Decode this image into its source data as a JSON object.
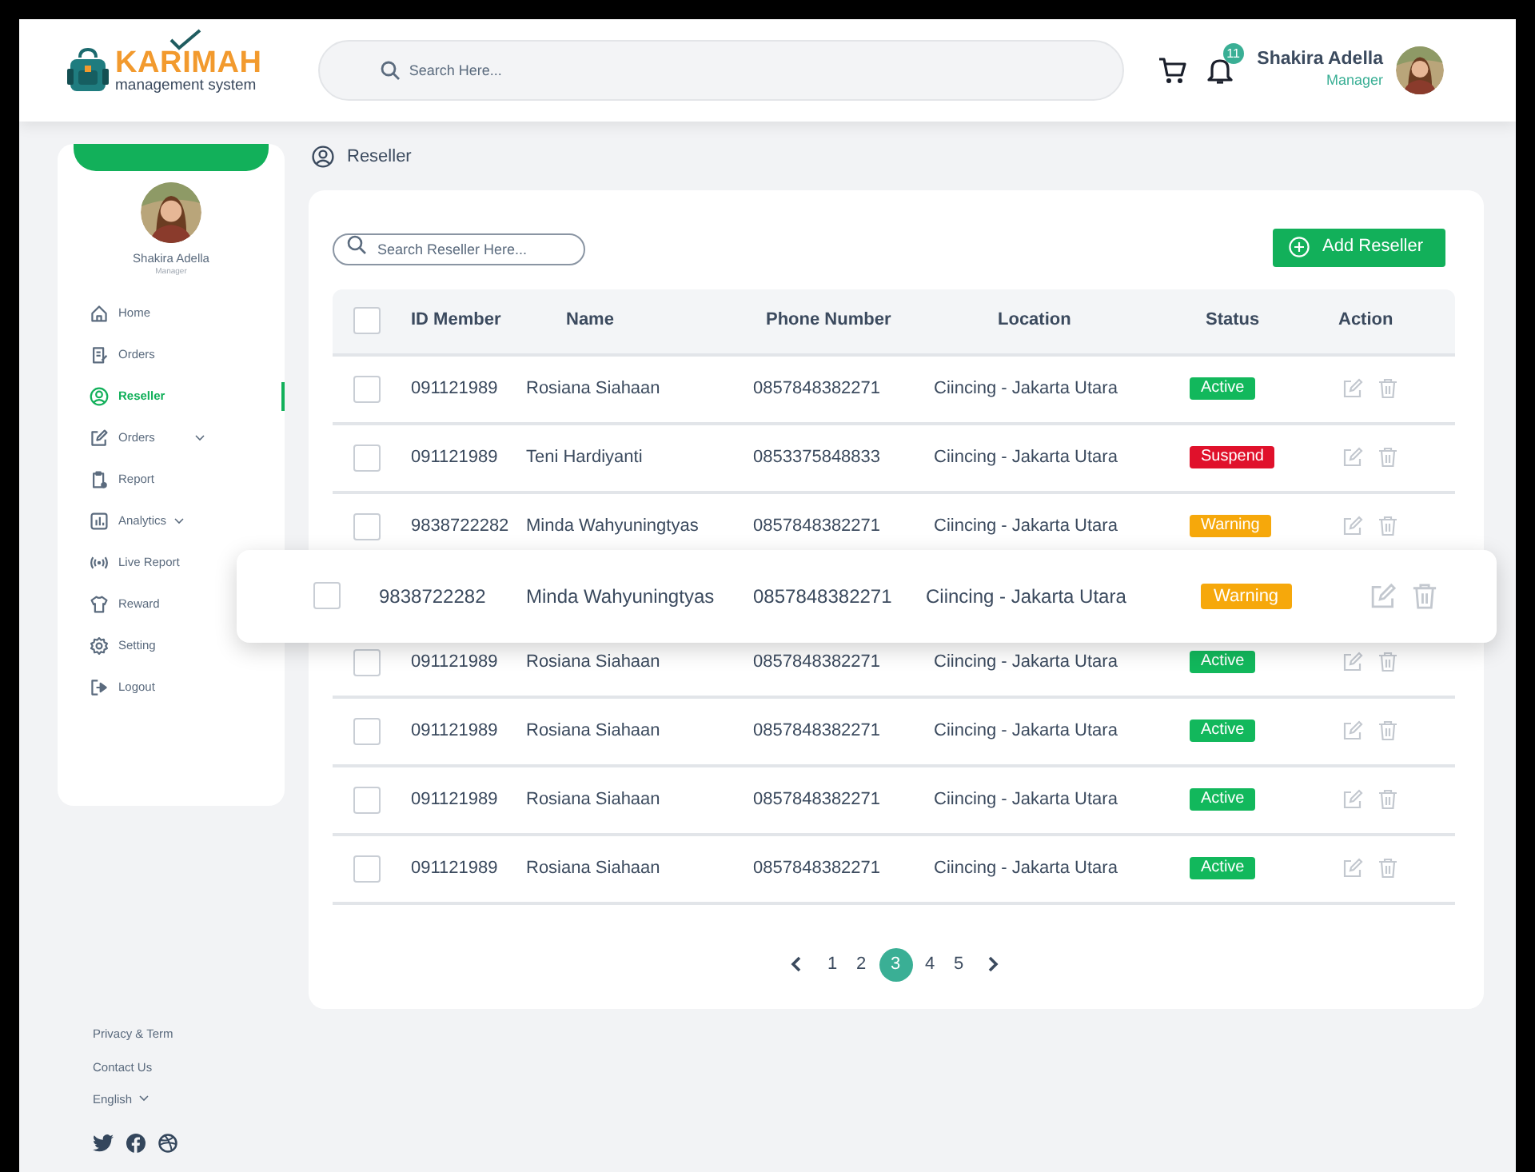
{
  "header": {
    "logo": {
      "title": "KARIMAH",
      "tagline": "management system"
    },
    "search": {
      "placeholder": "Search Here..."
    },
    "notifications": {
      "count": "11"
    },
    "user": {
      "name": "Shakira Adella",
      "role": "Manager"
    }
  },
  "sidebar": {
    "profile": {
      "name": "Shakira Adella",
      "role": "Manager"
    },
    "items": [
      {
        "label": "Home",
        "selected": false,
        "submenu": false
      },
      {
        "label": "Orders",
        "selected": false,
        "submenu": false
      },
      {
        "label": "Reseller",
        "selected": true,
        "submenu": false
      },
      {
        "label": "Orders",
        "selected": false,
        "submenu": true
      },
      {
        "label": "Report",
        "selected": false,
        "submenu": false
      },
      {
        "label": "Analytics",
        "selected": false,
        "submenu": true
      },
      {
        "label": "Live Report",
        "selected": false,
        "submenu": false
      },
      {
        "label": "Reward",
        "selected": false,
        "submenu": false
      },
      {
        "label": "Setting",
        "selected": false,
        "submenu": false
      },
      {
        "label": "Logout",
        "selected": false,
        "submenu": false
      }
    ],
    "footer_links": [
      "Privacy & Term",
      "Contact Us"
    ],
    "language": "English"
  },
  "breadcrumb": "Reseller",
  "reseller_search": {
    "placeholder": "Search Reseller Here..."
  },
  "add_button": "Add Reseller",
  "table": {
    "header_checked": false,
    "columns": [
      "ID Member",
      "Name",
      "Phone Number",
      "Location",
      "Status",
      "Action"
    ],
    "rows": [
      {
        "id": "091121989",
        "name": "Rosiana Siahaan",
        "phone": "0857848382271",
        "location": "Ciincing - Jakarta Utara",
        "status": "Active",
        "color": "#12b85c",
        "checked": false,
        "lifted": false
      },
      {
        "id": "091121989",
        "name": "Teni Hardiyanti",
        "phone": "0853375848833",
        "location": "Ciincing - Jakarta Utara",
        "status": "Suspend",
        "color": "#e0112b",
        "checked": false,
        "lifted": false
      },
      {
        "id": "9838722282",
        "name": "Minda Wahyuningtyas",
        "phone": "0857848382271",
        "location": "Ciincing - Jakarta Utara",
        "status": "Warning",
        "color": "#f6a80b",
        "checked": false,
        "lifted": false
      },
      {
        "id": "9838722282",
        "name": "Minda Wahyuningtyas",
        "phone": "0857848382271",
        "location": "Ciincing - Jakarta Utara",
        "status": "Warning",
        "color": "#f6a80b",
        "checked": false,
        "lifted": true
      },
      {
        "id": "091121989",
        "name": "Rosiana Siahaan",
        "phone": "0857848382271",
        "location": "Ciincing - Jakarta Utara",
        "status": "Active",
        "color": "#12b85c",
        "checked": false,
        "lifted": false
      },
      {
        "id": "091121989",
        "name": "Rosiana Siahaan",
        "phone": "0857848382271",
        "location": "Ciincing - Jakarta Utara",
        "status": "Active",
        "color": "#12b85c",
        "checked": false,
        "lifted": false
      },
      {
        "id": "091121989",
        "name": "Rosiana Siahaan",
        "phone": "0857848382271",
        "location": "Ciincing - Jakarta Utara",
        "status": "Active",
        "color": "#12b85c",
        "checked": false,
        "lifted": false
      },
      {
        "id": "091121989",
        "name": "Rosiana Siahaan",
        "phone": "0857848382271",
        "location": "Ciincing - Jakarta Utara",
        "status": "Active",
        "color": "#12b85c",
        "checked": false,
        "lifted": false
      }
    ]
  },
  "pagination": {
    "pages": [
      {
        "label": "1",
        "selected": false
      },
      {
        "label": "2",
        "selected": false
      },
      {
        "label": "3",
        "selected": true
      },
      {
        "label": "4",
        "selected": false
      },
      {
        "label": "5",
        "selected": false
      }
    ]
  }
}
